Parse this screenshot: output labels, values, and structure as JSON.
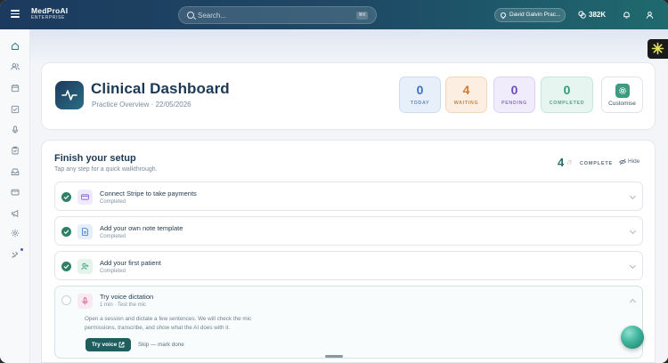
{
  "app": {
    "name": "MedProAI",
    "tier": "ENTERPRISE"
  },
  "search": {
    "placeholder": "Search...",
    "shortcut": "⌘K"
  },
  "header": {
    "practice": "David Galvin Prac...",
    "credits": "382K"
  },
  "sidebar": {
    "items": [
      {
        "icon": "home-icon",
        "active": true
      },
      {
        "icon": "users-icon"
      },
      {
        "icon": "calendar-icon"
      },
      {
        "icon": "tasks-icon"
      },
      {
        "icon": "microphone-icon"
      },
      {
        "icon": "clipboard-icon"
      },
      {
        "icon": "inbox-icon"
      },
      {
        "icon": "card-icon"
      },
      {
        "icon": "megaphone-icon"
      },
      {
        "icon": "settings-icon"
      },
      {
        "icon": "integrations-icon"
      }
    ]
  },
  "dashboard": {
    "title": "Clinical Dashboard",
    "subtitle": "Practice Overview · 22/05/2026",
    "stats": [
      {
        "key": "today",
        "value": "0",
        "label": "TODAY",
        "color": "#3b70c8"
      },
      {
        "key": "waiting",
        "value": "4",
        "label": "WAITING",
        "color": "#d57a28"
      },
      {
        "key": "pending",
        "value": "0",
        "label": "PENDING",
        "color": "#6c4bc6"
      },
      {
        "key": "completed",
        "value": "0",
        "label": "COMPLETED",
        "color": "#2f9c77"
      }
    ],
    "customise_label": "Customise"
  },
  "setup": {
    "title": "Finish your setup",
    "subtitle": "Tap any step for a quick walkthrough.",
    "done": "4",
    "total": "/7",
    "complete_label": "COMPLETE",
    "hide_label": "Hide",
    "steps": [
      {
        "title": "Connect Stripe to take payments",
        "status": "Completed",
        "icon": "credit-card-icon",
        "done": true
      },
      {
        "title": "Add your own note template",
        "status": "Completed",
        "icon": "document-icon",
        "done": true
      },
      {
        "title": "Add your first patient",
        "status": "Completed",
        "icon": "add-user-icon",
        "done": true
      },
      {
        "title": "Try voice dictation",
        "status": "1 min · Test the mic",
        "icon": "microphone-icon",
        "done": false,
        "description": "Open a session and dictate a few sentences. We will check the mic permissions, transcribe, and show what the AI does with it.",
        "primary_action": "Try voice",
        "secondary_action": "Skip — mark done"
      }
    ]
  },
  "colors": {
    "brand": "#1c3a5e",
    "accent": "#2f7f67"
  }
}
